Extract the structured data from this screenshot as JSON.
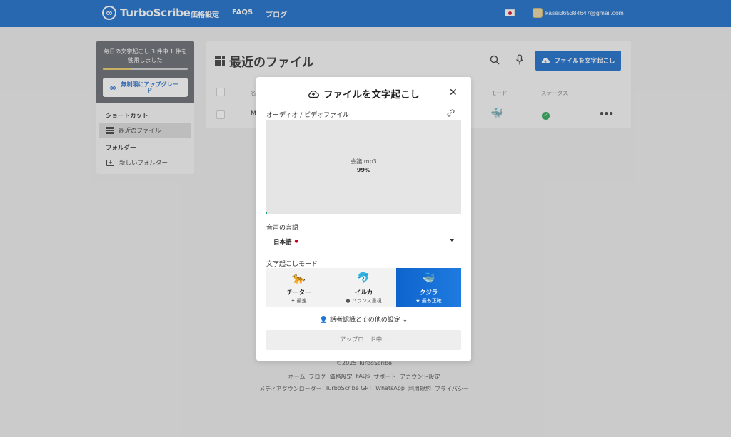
{
  "nav": {
    "brand": "TurboScribe",
    "links": [
      "価格設定",
      "FAQS",
      "ブログ"
    ],
    "email": "kasei365384647@gmail.com"
  },
  "sidebar": {
    "usage_text": "毎日の文字起こし 3 件中 1 件を使用しました",
    "usage_fraction": 0.33,
    "upgrade_label": "無制限にアップグレード",
    "shortcuts_heading": "ショートカット",
    "recent_files": "最近のファイル",
    "folders_heading": "フォルダー",
    "new_folder": "新しいフォルダー"
  },
  "main": {
    "title": "最近のファイル",
    "transcribe_button": "ファイルを文字起こし",
    "columns": {
      "name": "名",
      "mode": "モード",
      "status": "ステータス"
    },
    "row": {
      "name_initial": "M",
      "more": "•••"
    }
  },
  "modal": {
    "title": "ファイルを文字起こし",
    "close": "✕",
    "audio_label": "オーディオ / ビデオファイル",
    "file_name": "会議.mp3",
    "progress_text": "99%",
    "progress_fraction": 0.005,
    "language_label": "音声の言語",
    "language_value": "日本語",
    "language_required": "●",
    "mode_label": "文字起こしモード",
    "modes": [
      {
        "emoji": "🐆",
        "name": "チーター",
        "sub": "✦ 最速"
      },
      {
        "emoji": "🐬",
        "name": "イルカ",
        "sub": "● バランス重視"
      },
      {
        "emoji": "🐳",
        "name": "クジラ",
        "sub": "★ 最も正確"
      }
    ],
    "selected_mode": 2,
    "advanced": "話者認識とその他の設定",
    "upload_button": "アップロード中..."
  },
  "footer": {
    "copyright": "©2025 TurboScribe",
    "line1": [
      "ホーム",
      "ブログ",
      "価格設定",
      "FAQs",
      "サポート",
      "アカウント設定"
    ],
    "line2": [
      "メディアダウンローダー",
      "TurboScribe GPT",
      "WhatsApp",
      "利用規約",
      "プライバシー"
    ]
  }
}
